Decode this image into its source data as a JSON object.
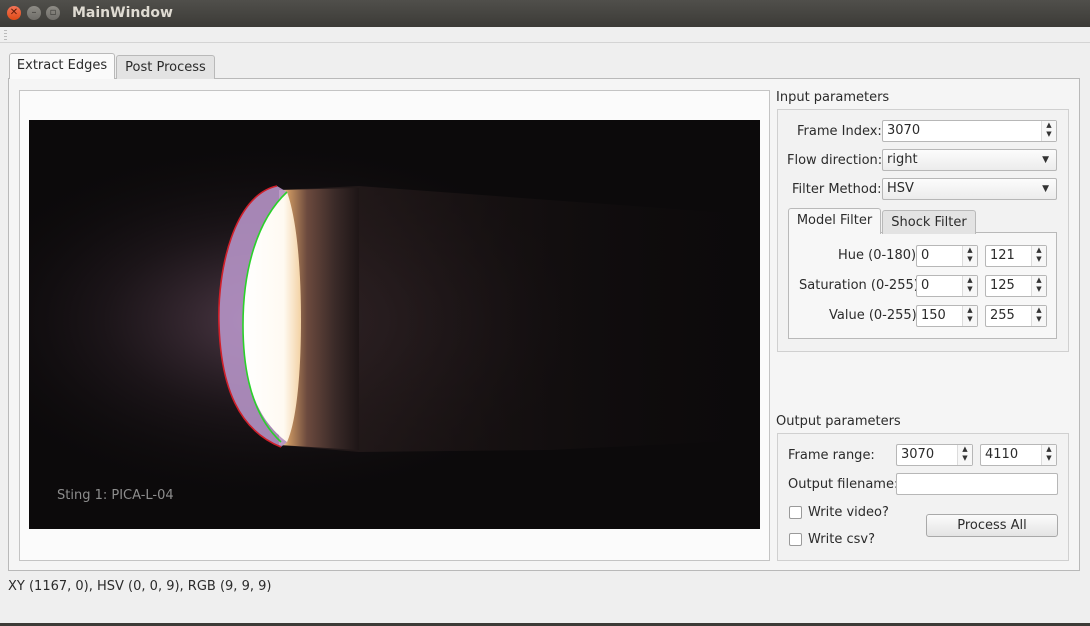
{
  "window": {
    "title": "MainWindow"
  },
  "tabs": [
    {
      "label": "Extract Edges",
      "active": true
    },
    {
      "label": "Post Process",
      "active": false
    }
  ],
  "video": {
    "overlay_text": "Sting 1: PICA-L-04"
  },
  "input_parameters": {
    "title": "Input parameters",
    "frame_index": {
      "label": "Frame Index:",
      "value": "3070"
    },
    "flow_direction": {
      "label": "Flow direction:",
      "value": "right"
    },
    "filter_method": {
      "label": "Filter Method:",
      "value": "HSV"
    },
    "filter_tabs": [
      {
        "label": "Model Filter",
        "active": true
      },
      {
        "label": "Shock Filter",
        "active": false
      }
    ],
    "hue": {
      "label": "Hue (0-180)",
      "min": "0",
      "max": "121"
    },
    "saturation": {
      "label": "Saturation (0-255)",
      "min": "0",
      "max": "125"
    },
    "value": {
      "label": "Value (0-255)",
      "min": "150",
      "max": "255"
    }
  },
  "output_parameters": {
    "title": "Output parameters",
    "frame_range": {
      "label": "Frame range:",
      "start": "3070",
      "end": "4110"
    },
    "output_filename": {
      "label": "Output filename:",
      "value": ""
    },
    "write_video": {
      "label": "Write video?",
      "checked": false
    },
    "write_csv": {
      "label": "Write csv?",
      "checked": false
    },
    "process_all_label": "Process All"
  },
  "status": {
    "text": "XY (1167, 0), HSV (0, 0, 9), RGB (9, 9, 9)"
  },
  "colors": {
    "edge_outer": "#d0202a",
    "edge_inner": "#2bd12b",
    "titlebar": "#3c3b37"
  }
}
